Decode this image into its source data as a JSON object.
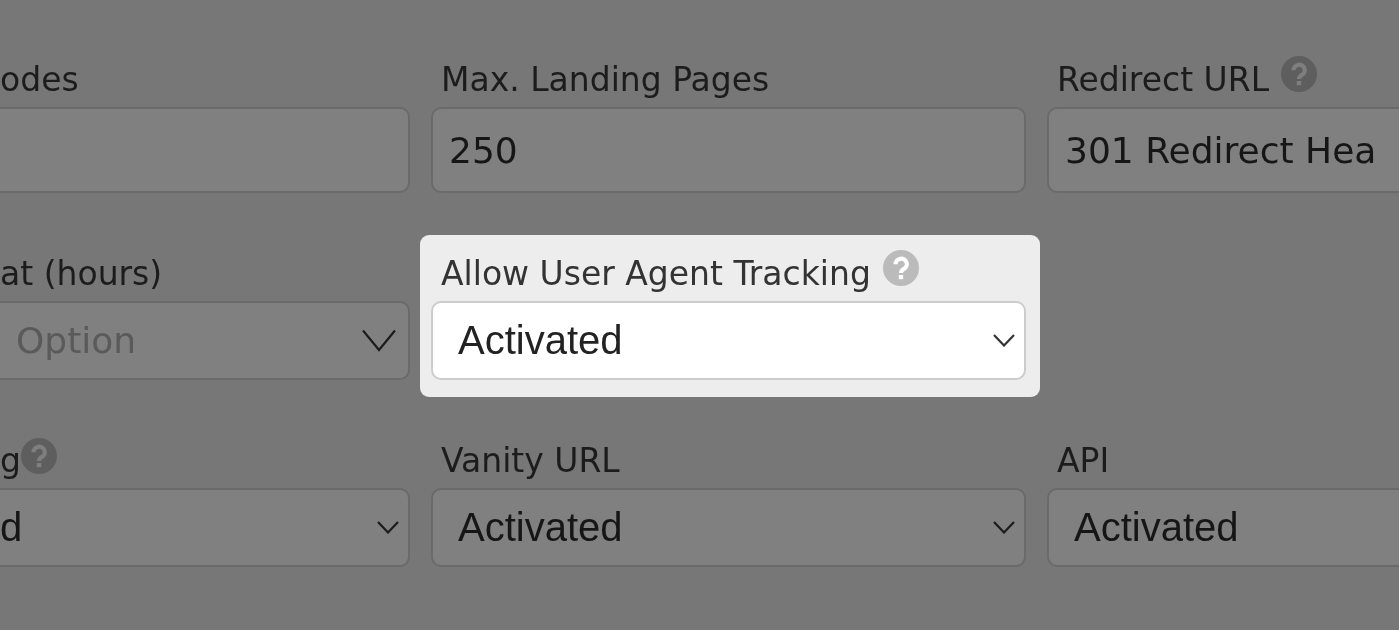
{
  "form": {
    "rows": [
      {
        "fields": [
          {
            "label": "odes",
            "help": false,
            "kind": "text",
            "highlighted": false
          },
          {
            "label": "Max. Landing Pages",
            "help": false,
            "kind": "text",
            "value": "250",
            "highlighted": false
          },
          {
            "label": "Redirect URL",
            "help": true,
            "kind": "text",
            "value": "301 Redirect Hea",
            "highlighted": false
          }
        ]
      },
      {
        "fields": [
          {
            "label": "at (hours)",
            "help": false,
            "kind": "select",
            "placeholder": "Option",
            "highlighted": false
          },
          {
            "label": "Allow User Agent Tracking",
            "help": true,
            "kind": "select",
            "value": "Activated",
            "highlighted": true
          }
        ]
      },
      {
        "fields": [
          {
            "label": "g",
            "help": true,
            "kind": "select",
            "value": "d",
            "highlighted": false
          },
          {
            "label": "Vanity URL",
            "help": false,
            "kind": "select",
            "value": "Activated",
            "highlighted": false
          },
          {
            "label": "API",
            "help": false,
            "kind": "select",
            "value": "Activated",
            "highlighted": false
          }
        ]
      }
    ]
  }
}
